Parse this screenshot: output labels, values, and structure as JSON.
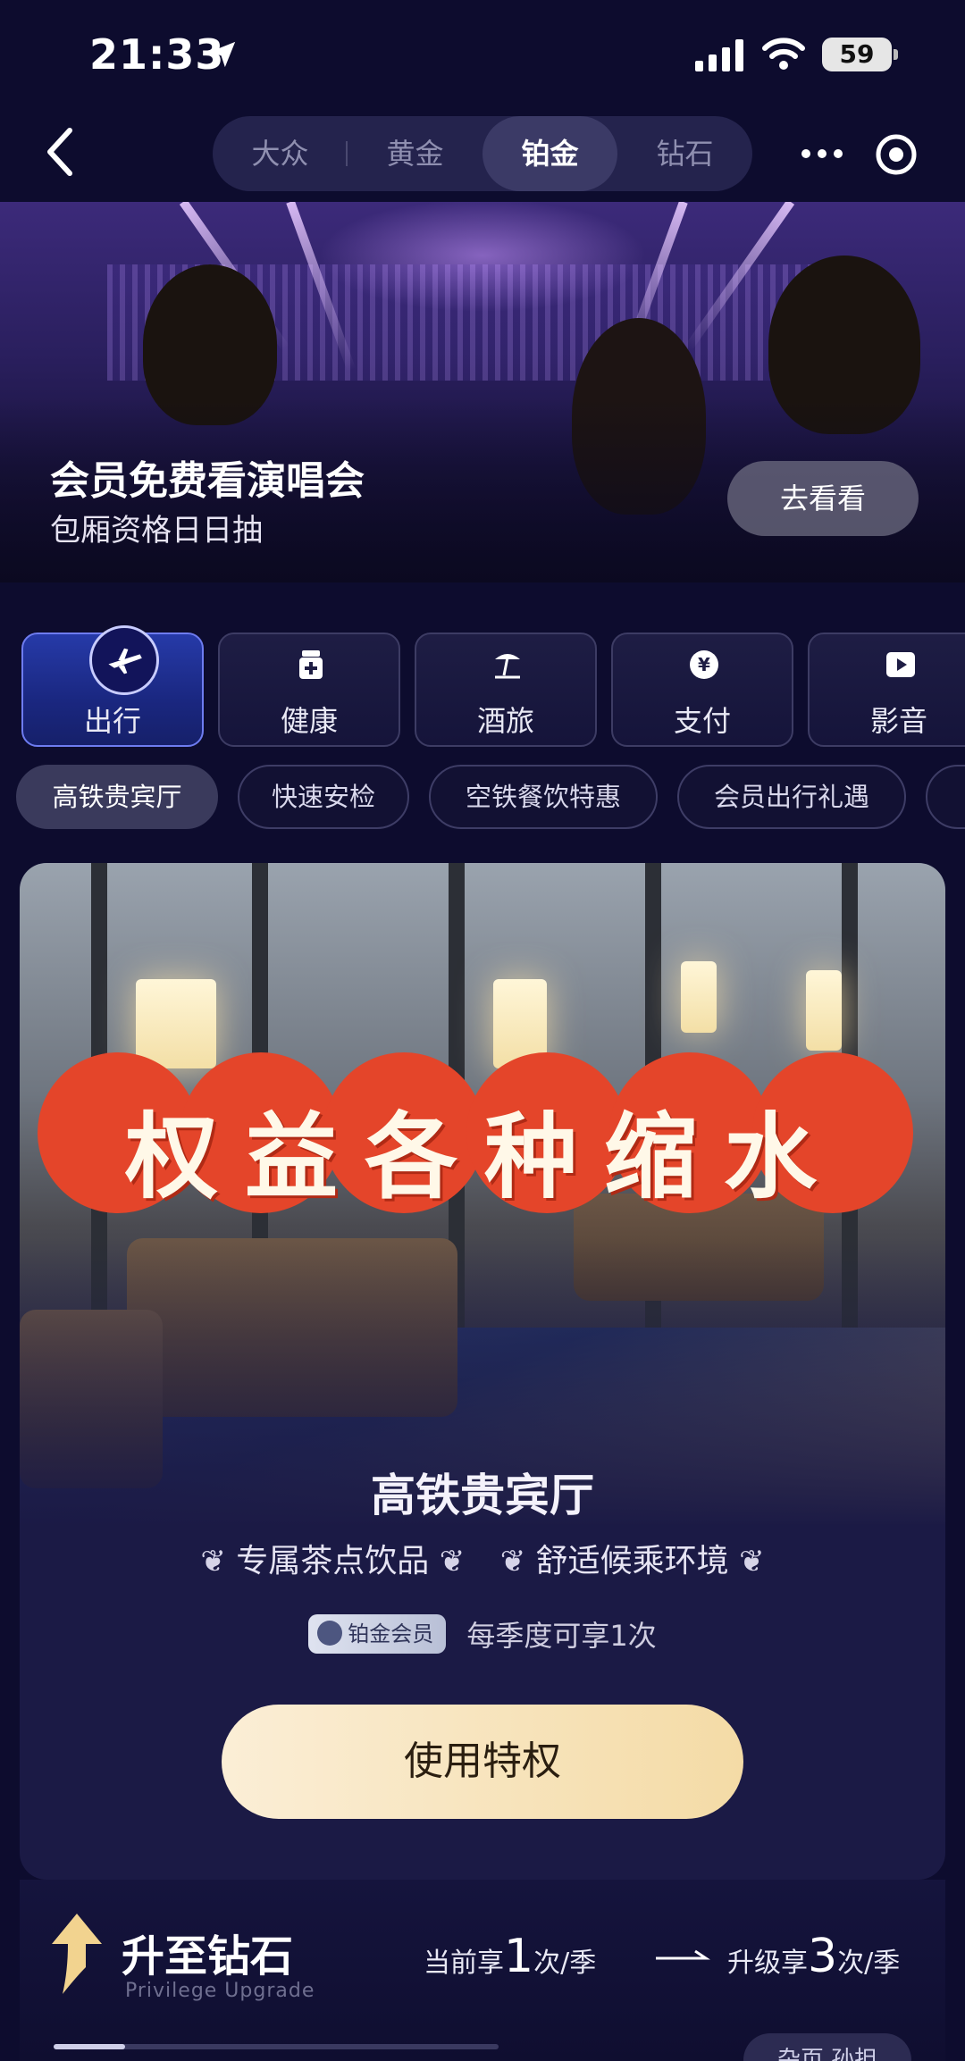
{
  "status_bar": {
    "time": "21:33",
    "battery": "59"
  },
  "nav": {
    "tiers": [
      "大众",
      "黄金",
      "铂金",
      "钻石"
    ],
    "active_tier": "铂金"
  },
  "banner": {
    "title": "会员免费看演唱会",
    "subtitle": "包厢资格日日抽",
    "button": "去看看"
  },
  "categories": [
    {
      "label": "出行",
      "icon": "plane-icon",
      "active": true
    },
    {
      "label": "健康",
      "icon": "medicine-bottle-icon"
    },
    {
      "label": "酒旅",
      "icon": "beach-umbrella-icon"
    },
    {
      "label": "支付",
      "icon": "yuan-coin-icon"
    },
    {
      "label": "影音",
      "icon": "play-icon"
    }
  ],
  "chips": [
    {
      "label": "高铁贵宾厅",
      "active": true
    },
    {
      "label": "快速安检"
    },
    {
      "label": "空铁餐饮特惠"
    },
    {
      "label": "会员出行礼遇"
    }
  ],
  "card": {
    "overlay_text": "权益各种缩水",
    "title": "高铁贵宾厅",
    "perk_1": "专属茶点饮品",
    "perk_2": "舒适候乘环境",
    "badge": "铂金会员",
    "frequency": "每季度可享1次",
    "button": "使用特权"
  },
  "upgrade": {
    "title": "升至钻石",
    "subtitle": "Privilege Upgrade",
    "current_prefix": "当前享",
    "current_count": "1",
    "current_suffix": "次/季",
    "new_prefix": "升级享",
    "new_count": "3",
    "new_suffix": "次/季",
    "more_button": "杂页 孙担"
  },
  "colors": {
    "background": "#0d0c2e",
    "accent_blue": "#263aa8",
    "gold_button": "#f4dba6",
    "stamp_red": "#e4452a"
  }
}
